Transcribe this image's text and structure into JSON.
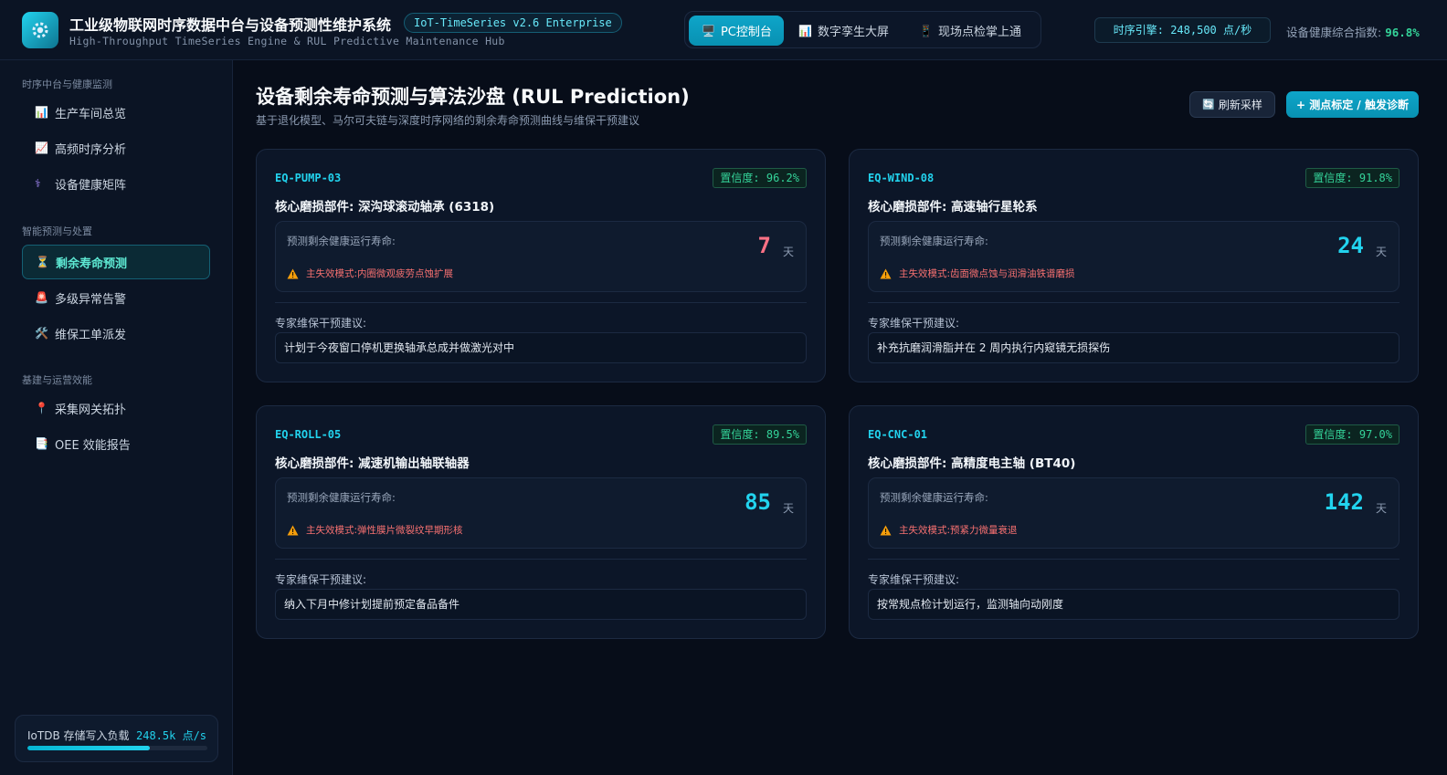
{
  "header": {
    "title": "工业级物联网时序数据中台与设备预测性维护系统",
    "version": "IoT-TimeSeries v2.6 Enterprise",
    "subtitle": "High-Throughput TimeSeries Engine & RUL Predictive Maintenance Hub",
    "logo_icon": "gear-icon",
    "view_tabs": [
      {
        "label": "PC控制台",
        "icon": "monitor-icon",
        "active": true
      },
      {
        "label": "数字孪生大屏",
        "icon": "bar-chart-icon",
        "active": false
      },
      {
        "label": "现场点检掌上通",
        "icon": "mobile-icon",
        "active": false
      }
    ],
    "engine_status": "时序引擎: 248,500 点/秒",
    "health_label": "设备健康综合指数:",
    "health_value": "96.8%"
  },
  "sidebar": {
    "groups": [
      {
        "title": "时序中台与健康监测",
        "items": [
          {
            "label": "生产车间总览",
            "icon": "bar-chart-icon"
          },
          {
            "label": "高频时序分析",
            "icon": "line-chart-icon"
          },
          {
            "label": "设备健康矩阵",
            "icon": "stethoscope-icon"
          }
        ]
      },
      {
        "title": "智能预测与处置",
        "items": [
          {
            "label": "剩余寿命预测",
            "icon": "hourglass-icon",
            "active": true
          },
          {
            "label": "多级异常告警",
            "icon": "siren-icon"
          },
          {
            "label": "维保工单派发",
            "icon": "tools-icon"
          }
        ]
      },
      {
        "title": "基建与运营效能",
        "items": [
          {
            "label": "采集网关拓扑",
            "icon": "pin-icon"
          },
          {
            "label": "OEE 效能报告",
            "icon": "report-icon"
          }
        ]
      }
    ],
    "load": {
      "label": "IoTDB 存储写入负载",
      "value": "248.5k 点/s",
      "fill_fraction": 0.68
    }
  },
  "main": {
    "title": "设备剩余寿命预测与算法沙盘 (RUL Prediction)",
    "description": "基于退化模型、马尔可夫链与深度时序网络的剩余寿命预测曲线与维保干预建议",
    "refresh_label": "刷新采样",
    "calibrate_label": "+ 测点标定 / 触发诊断",
    "rul_label": "预测剩余健康运行寿命:",
    "unit_label": "天",
    "advice_label": "专家维保干预建议:",
    "fail_prefix": "主失效模式: ",
    "cards": [
      {
        "id": "EQ-PUMP-03",
        "confidence": "置信度: 96.2%",
        "part": "核心磨损部件: 深沟球滚动轴承 (6318)",
        "days": "7",
        "critical": true,
        "failure": "内圈微观疲劳点蚀扩展",
        "advice": "计划于今夜窗口停机更换轴承总成并做激光对中"
      },
      {
        "id": "EQ-WIND-08",
        "confidence": "置信度: 91.8%",
        "part": "核心磨损部件: 高速轴行星轮系",
        "days": "24",
        "critical": false,
        "failure": "齿面微点蚀与润滑油铁谱磨损",
        "advice": "补充抗磨润滑脂并在 2 周内执行内窥镜无损探伤"
      },
      {
        "id": "EQ-ROLL-05",
        "confidence": "置信度: 89.5%",
        "part": "核心磨损部件: 减速机输出轴联轴器",
        "days": "85",
        "critical": false,
        "failure": "弹性膜片微裂纹早期形核",
        "advice": "纳入下月中修计划提前预定备品备件"
      },
      {
        "id": "EQ-CNC-01",
        "confidence": "置信度: 97.0%",
        "part": "核心磨损部件: 高精度电主轴 (BT40)",
        "days": "142",
        "critical": false,
        "failure": "预紧力微量衰退",
        "advice": "按常规点检计划运行，监测轴向动刚度"
      }
    ]
  },
  "colors": {
    "accent": "#22d3ee",
    "critical": "#fb7185",
    "ok": "#34d399",
    "warning": "#f59e0b"
  }
}
